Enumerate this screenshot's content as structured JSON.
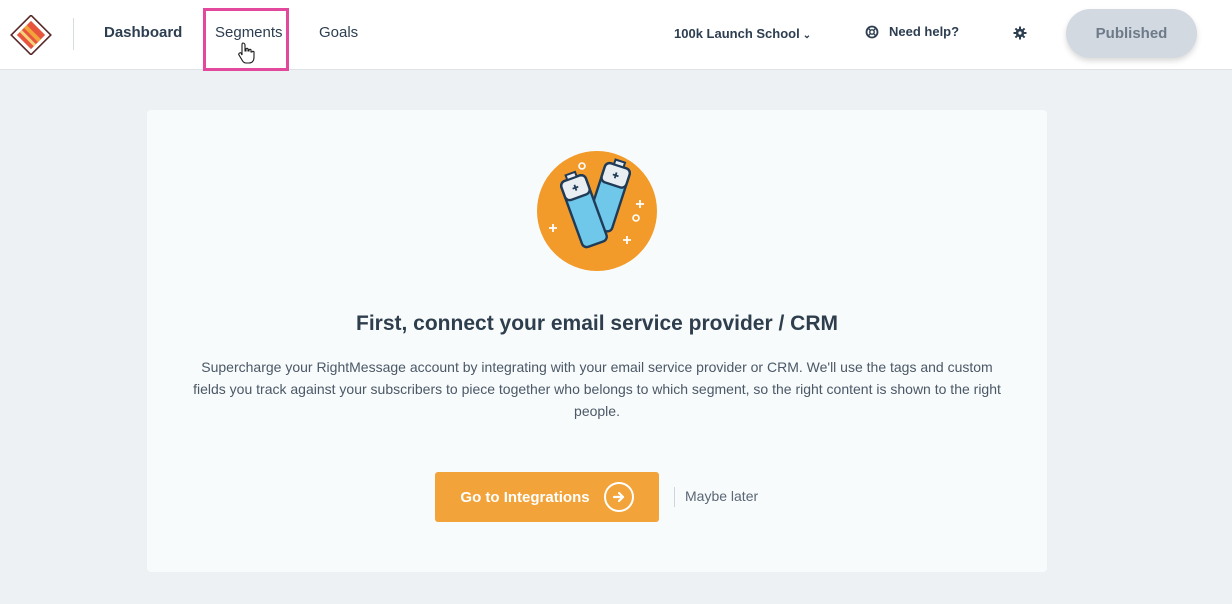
{
  "nav": {
    "items": [
      {
        "label": "Dashboard"
      },
      {
        "label": "Segments"
      },
      {
        "label": "Goals"
      }
    ],
    "account_label": "100k Launch School",
    "help_label": "Need help?",
    "published_label": "Published"
  },
  "main": {
    "heading": "First, connect your email service provider / CRM",
    "description": "Supercharge your RightMessage account by integrating with your email service provider or CRM. We'll use the tags and custom fields you track against your subscribers to piece together who belongs to which segment, so the right content is shown to the right people.",
    "primary_button": "Go to Integrations",
    "secondary_link": "Maybe later"
  },
  "colors": {
    "accent": "#f2a43a",
    "highlight": "#e2489c",
    "background": "#eef1f4"
  },
  "icons": [
    "logo-icon",
    "chevron-down-icon",
    "lifebuoy-icon",
    "gear-icon",
    "battery-illustration",
    "arrow-right-icon",
    "hand-cursor-icon"
  ]
}
